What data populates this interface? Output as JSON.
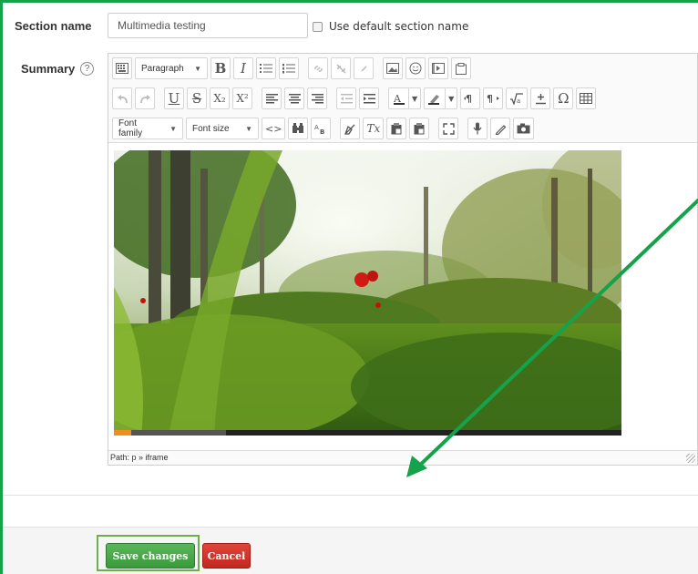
{
  "form": {
    "section_name_label": "Section name",
    "section_name_value": "Multimedia testing",
    "use_default_label": "Use default section name",
    "summary_label": "Summary",
    "help_glyph": "?"
  },
  "toolbar": {
    "row1": {
      "block_format": "Paragraph",
      "bold": "B",
      "italic": "I"
    },
    "row2": {
      "underline": "U",
      "strike": "S",
      "subscript": "X₂",
      "superscript": "X²",
      "omega": "Ω"
    },
    "row3": {
      "font_family": "Font family",
      "font_size": "Font size",
      "code": "<>",
      "clear_format": "Tx"
    }
  },
  "editor": {
    "path_text": "Path: p » iframe",
    "video_progress": 0.035,
    "video_buffered": 0.22
  },
  "buttons": {
    "save": "Save changes",
    "cancel": "Cancel"
  },
  "colors": {
    "highlight_green": "#14a24a",
    "save_green": "#3a9a3a",
    "cancel_red": "#c1281f"
  }
}
